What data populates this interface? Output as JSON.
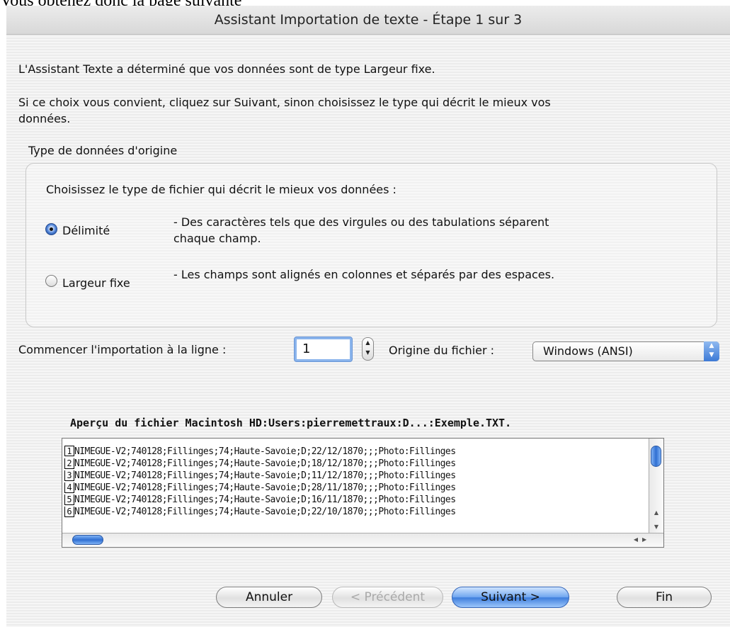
{
  "caption": "Vous obtenez donc la page suivante",
  "window": {
    "title": "Assistant Importation de texte - Étape 1 sur 3"
  },
  "intro": {
    "line1": "L'Assistant Texte a déterminé que vos données sont de type Largeur fixe.",
    "line2a": "Si ce choix vous convient, cliquez sur Suivant, sinon choisissez le type qui décrit le mieux vos",
    "line2b": "données."
  },
  "group": {
    "title": "Type de données d'origine",
    "prompt": "Choisissez le type de fichier qui décrit le mieux vos données :",
    "options": [
      {
        "label": "Délimité",
        "desc_a": "- Des caractères tels que des virgules ou des tabulations séparent",
        "desc_b": "chaque champ.",
        "selected": true
      },
      {
        "label": "Largeur fixe",
        "desc_a": "- Les champs sont alignés en colonnes et séparés par des espaces.",
        "desc_b": "",
        "selected": false
      }
    ]
  },
  "start_row": {
    "label": "Commencer l'importation à la ligne :",
    "value": "1"
  },
  "origin": {
    "label": "Origine du fichier :",
    "value": "Windows (ANSI)"
  },
  "preview": {
    "title": "Aperçu du fichier Macintosh HD:Users:pierremettraux:D...:Exemple.TXT.",
    "rows": [
      {
        "num": "1",
        "text": "NIMEGUE-V2;740128;Fillinges;74;Haute-Savoie;D;22/12/1870;;;Photo:Fillinges"
      },
      {
        "num": "2",
        "text": "NIMEGUE-V2;740128;Fillinges;74;Haute-Savoie;D;18/12/1870;;;Photo:Fillinges"
      },
      {
        "num": "3",
        "text": "NIMEGUE-V2;740128;Fillinges;74;Haute-Savoie;D;11/12/1870;;;Photo:Fillinges"
      },
      {
        "num": "4",
        "text": "NIMEGUE-V2;740128;Fillinges;74;Haute-Savoie;D;28/11/1870;;;Photo:Fillinges"
      },
      {
        "num": "5",
        "text": "NIMEGUE-V2;740128;Fillinges;74;Haute-Savoie;D;16/11/1870;;;Photo:Fillinges"
      },
      {
        "num": "6",
        "text": "NIMEGUE-V2;740128;Fillinges;74;Haute-Savoie;D;22/10/1870;;;Photo:Fillinges"
      }
    ]
  },
  "buttons": {
    "cancel": "Annuler",
    "previous": "< Précédent",
    "next": "Suivant >",
    "finish": "Fin"
  }
}
